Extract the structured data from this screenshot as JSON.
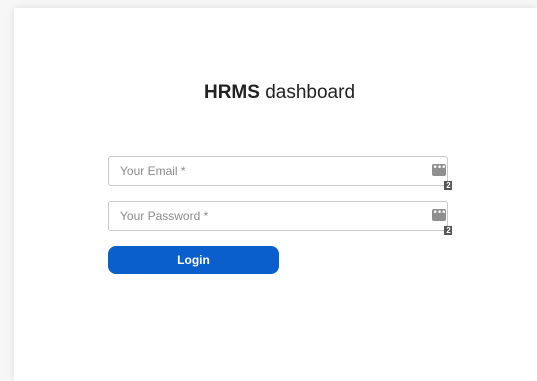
{
  "title": {
    "brand": "HRMS",
    "rest": "dashboard"
  },
  "form": {
    "email_placeholder": "Your Email *",
    "email_value": "",
    "password_placeholder": "Your Password *",
    "password_value": "",
    "password_manager_icon": "password-manager-icon",
    "password_manager_glyph": "•••",
    "password_manager_count": "2",
    "login_label": "Login"
  },
  "colors": {
    "accent": "#0a5fcc",
    "background": "#f7f7f7",
    "card": "#ffffff",
    "input_border": "#c9c9c9"
  }
}
